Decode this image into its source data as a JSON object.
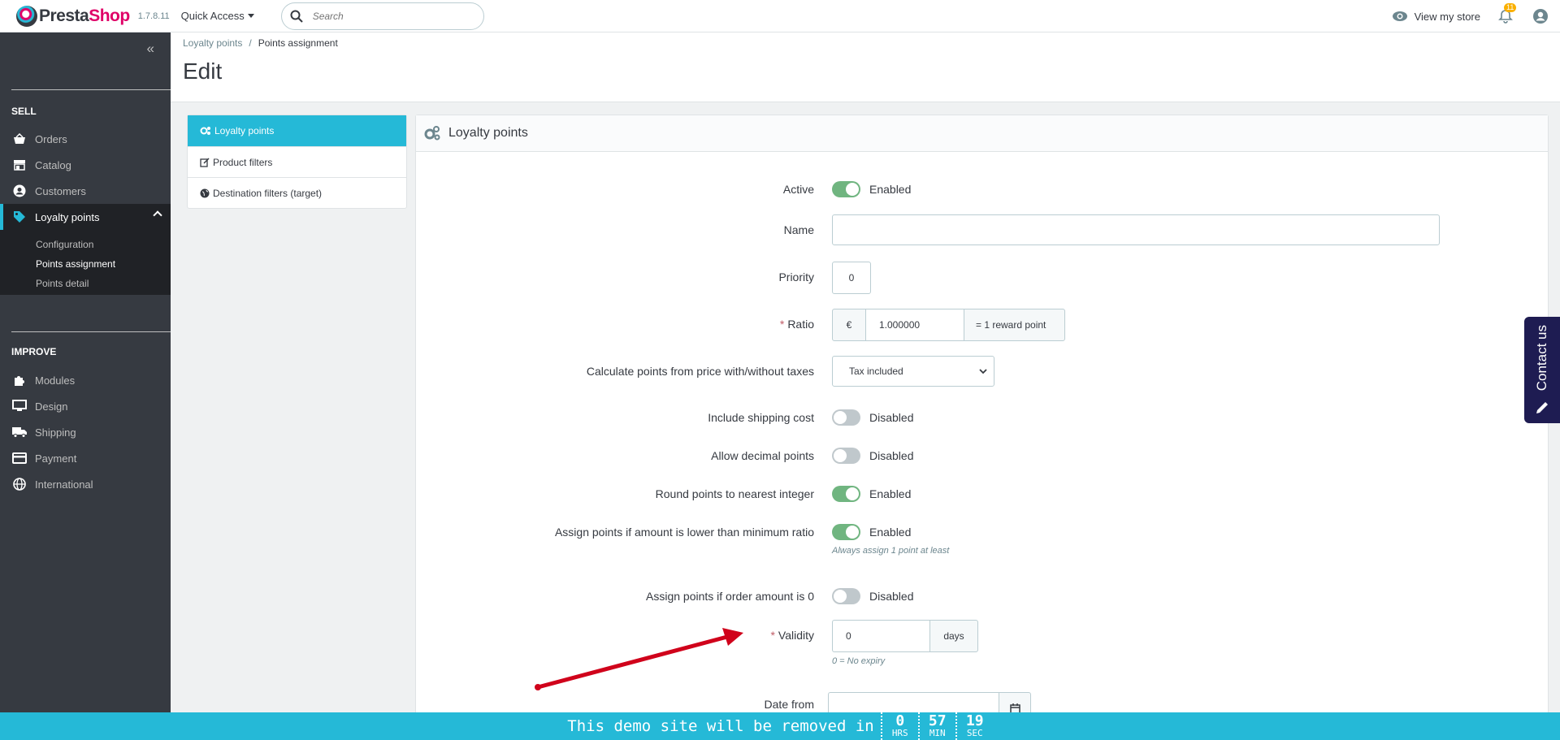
{
  "header": {
    "logo_text_a": "Presta",
    "logo_text_b": "Shop",
    "version": "1.7.8.11",
    "quick_access": "Quick Access",
    "search_placeholder": "Search",
    "view_store": "View my store",
    "notifications_count": "11"
  },
  "sidebar": {
    "sell_heading": "SELL",
    "sell_items": [
      {
        "label": "Orders",
        "icon": "basket-icon"
      },
      {
        "label": "Catalog",
        "icon": "store-icon"
      },
      {
        "label": "Customers",
        "icon": "account-circle-icon"
      },
      {
        "label": "Loyalty points",
        "icon": "tag-icon"
      }
    ],
    "loyalty_sub": [
      "Configuration",
      "Points assignment",
      "Points detail"
    ],
    "improve_heading": "IMPROVE",
    "improve_items": [
      {
        "label": "Modules",
        "icon": "puzzle-icon"
      },
      {
        "label": "Design",
        "icon": "desktop-icon"
      },
      {
        "label": "Shipping",
        "icon": "truck-icon"
      },
      {
        "label": "Payment",
        "icon": "credit-card-icon"
      },
      {
        "label": "International",
        "icon": "globe-icon"
      }
    ]
  },
  "breadcrumb": {
    "parent": "Loyalty points",
    "separator": "/",
    "current": "Points assignment"
  },
  "page_title": "Edit",
  "tabs": [
    {
      "label": "Loyalty points",
      "icon": "cogs-icon",
      "active": true
    },
    {
      "label": "Product filters",
      "icon": "edit-icon",
      "active": false
    },
    {
      "label": "Destination filters (target)",
      "icon": "globe-icon",
      "active": false
    }
  ],
  "panel": {
    "title": "Loyalty points",
    "fields": {
      "active": {
        "label": "Active",
        "state": "Enabled"
      },
      "name": {
        "label": "Name",
        "value": ""
      },
      "priority": {
        "label": "Priority",
        "value": "0"
      },
      "ratio": {
        "label": "Ratio",
        "required": "*",
        "prefix": "€",
        "value": "1.000000",
        "suffix": "= 1 reward point"
      },
      "calc": {
        "label": "Calculate points from price with/without taxes",
        "selected": "Tax included"
      },
      "shipping": {
        "label": "Include shipping cost",
        "state": "Disabled"
      },
      "decimal": {
        "label": "Allow decimal points",
        "state": "Disabled"
      },
      "round": {
        "label": "Round points to nearest integer",
        "state": "Enabled"
      },
      "assign_lower": {
        "label": "Assign points if amount is lower than minimum ratio",
        "state": "Enabled",
        "help": "Always assign 1 point at least"
      },
      "assign_zero": {
        "label": "Assign points if order amount is 0",
        "state": "Disabled"
      },
      "validity": {
        "label": "Validity",
        "required": "*",
        "value": "0",
        "suffix": "days",
        "help": "0 = No expiry"
      },
      "date_from": {
        "label": "Date from",
        "value": ""
      }
    }
  },
  "contact": {
    "label": "Contact us"
  },
  "demo_banner": {
    "text": "This demo site will be removed in",
    "hrs": "0",
    "hrs_unit": "HRS",
    "min": "57",
    "min_unit": "MIN",
    "sec": "19",
    "sec_unit": "SEC"
  },
  "colors": {
    "accent": "#25b9d7",
    "brand": "#df0067",
    "sidebar": "#363a41",
    "switch_on": "#70b580",
    "arrow": "#d0021b"
  }
}
